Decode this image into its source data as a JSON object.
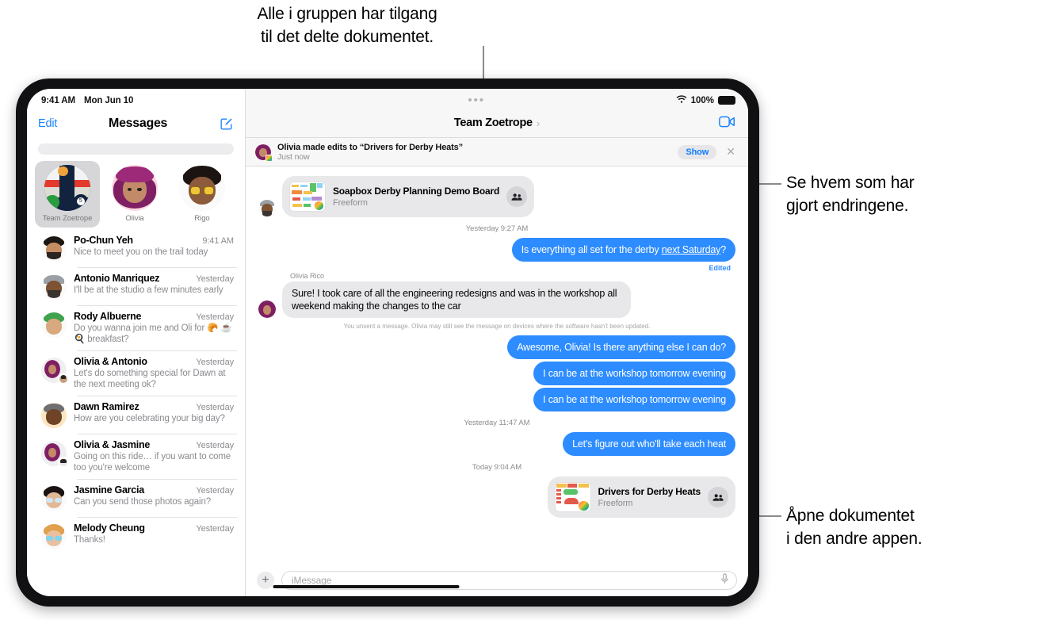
{
  "callouts": {
    "top": "Alle i gruppen har tilgang\ntil det delte dokumentet.",
    "right_upper": "Se hvem som har\ngjort endringene.",
    "right_lower": "Åpne dokumentet\ni den andre appen."
  },
  "status_bar": {
    "time": "9:41 AM",
    "date": "Mon Jun 10",
    "wifi_icon": "wifi-icon",
    "battery_percent": "100%"
  },
  "sidebar": {
    "edit_label": "Edit",
    "title": "Messages",
    "compose_icon": "compose-icon",
    "search_placeholder": "",
    "stories": [
      {
        "name": "Team Zoetrope",
        "active": true
      },
      {
        "name": "Olivia",
        "active": false
      },
      {
        "name": "Rigo",
        "active": false
      }
    ],
    "conversations": [
      {
        "name": "Po-Chun Yeh",
        "time": "9:41 AM",
        "preview": "Nice to meet you on the trail today"
      },
      {
        "name": "Antonio Manriquez",
        "time": "Yesterday",
        "preview": "I'll be at the studio a few minutes early"
      },
      {
        "name": "Rody Albuerne",
        "time": "Yesterday",
        "preview": "Do you wanna join me and Oli for 🥐 ☕ 🍳 breakfast?"
      },
      {
        "name": "Olivia & Antonio",
        "time": "Yesterday",
        "preview": "Let's do something special for Dawn at the next meeting ok?"
      },
      {
        "name": "Dawn Ramirez",
        "time": "Yesterday",
        "preview": "How are you celebrating your big day?"
      },
      {
        "name": "Olivia & Jasmine",
        "time": "Yesterday",
        "preview": "Going on this ride… if you want to come too you're welcome"
      },
      {
        "name": "Jasmine Garcia",
        "time": "Yesterday",
        "preview": "Can you send those photos again?"
      },
      {
        "name": "Melody Cheung",
        "time": "Yesterday",
        "preview": "Thanks!"
      }
    ]
  },
  "chat": {
    "title": "Team Zoetrope",
    "chevron_icon": "chevron-right-icon",
    "facetime_icon": "facetime-video-icon",
    "multitask_icon": "multitasking-dots-icon",
    "banner": {
      "avatar": "olivia-avatar",
      "title": "Olivia made edits to “Drivers for Derby Heats”",
      "subtitle": "Just now",
      "show_label": "Show",
      "close_icon": "close-icon"
    },
    "messages": [
      {
        "kind": "card",
        "side": "in",
        "title": "Soapbox Derby Planning Demo Board",
        "subtitle": "Freeform",
        "people_icon": "people-icon"
      },
      {
        "kind": "timestamp",
        "text": "Yesterday 9:27 AM"
      },
      {
        "kind": "bubble",
        "side": "out",
        "text_before": "Is everything all set for the derby ",
        "text_link": "next Saturday",
        "text_after": "?",
        "edited_label": "Edited"
      },
      {
        "kind": "sender",
        "text": "Olivia Rico"
      },
      {
        "kind": "bubble",
        "side": "in",
        "text": "Sure! I took care of all the engineering redesigns and was in the workshop all weekend making the changes to the car"
      },
      {
        "kind": "note",
        "text": "You unsent a message. Olivia may still see the message on devices where the software hasn't been updated."
      },
      {
        "kind": "bubble",
        "side": "out",
        "text": "Awesome, Olivia! Is there anything else I can do?"
      },
      {
        "kind": "bubble",
        "side": "out",
        "text": "I can be at the workshop tomorrow evening"
      },
      {
        "kind": "bubble",
        "side": "out",
        "text": "I can be at the workshop tomorrow evening"
      },
      {
        "kind": "timestamp",
        "text": "Yesterday 11:47 AM"
      },
      {
        "kind": "bubble",
        "side": "out",
        "text": "Let's figure out who'll take each heat"
      },
      {
        "kind": "timestamp",
        "text": "Today 9:04 AM"
      },
      {
        "kind": "card",
        "side": "out",
        "title": "Drivers for Derby Heats",
        "subtitle": "Freeform",
        "people_icon": "people-icon"
      }
    ],
    "composer": {
      "plus_icon": "plus-icon",
      "placeholder": "iMessage",
      "mic_icon": "microphone-icon"
    }
  },
  "colors": {
    "bubble_out": "#2d8cff",
    "bubble_in": "#e8e8ea",
    "link_blue": "#1a84ff",
    "chrome_gray": "#f7f7f7"
  }
}
